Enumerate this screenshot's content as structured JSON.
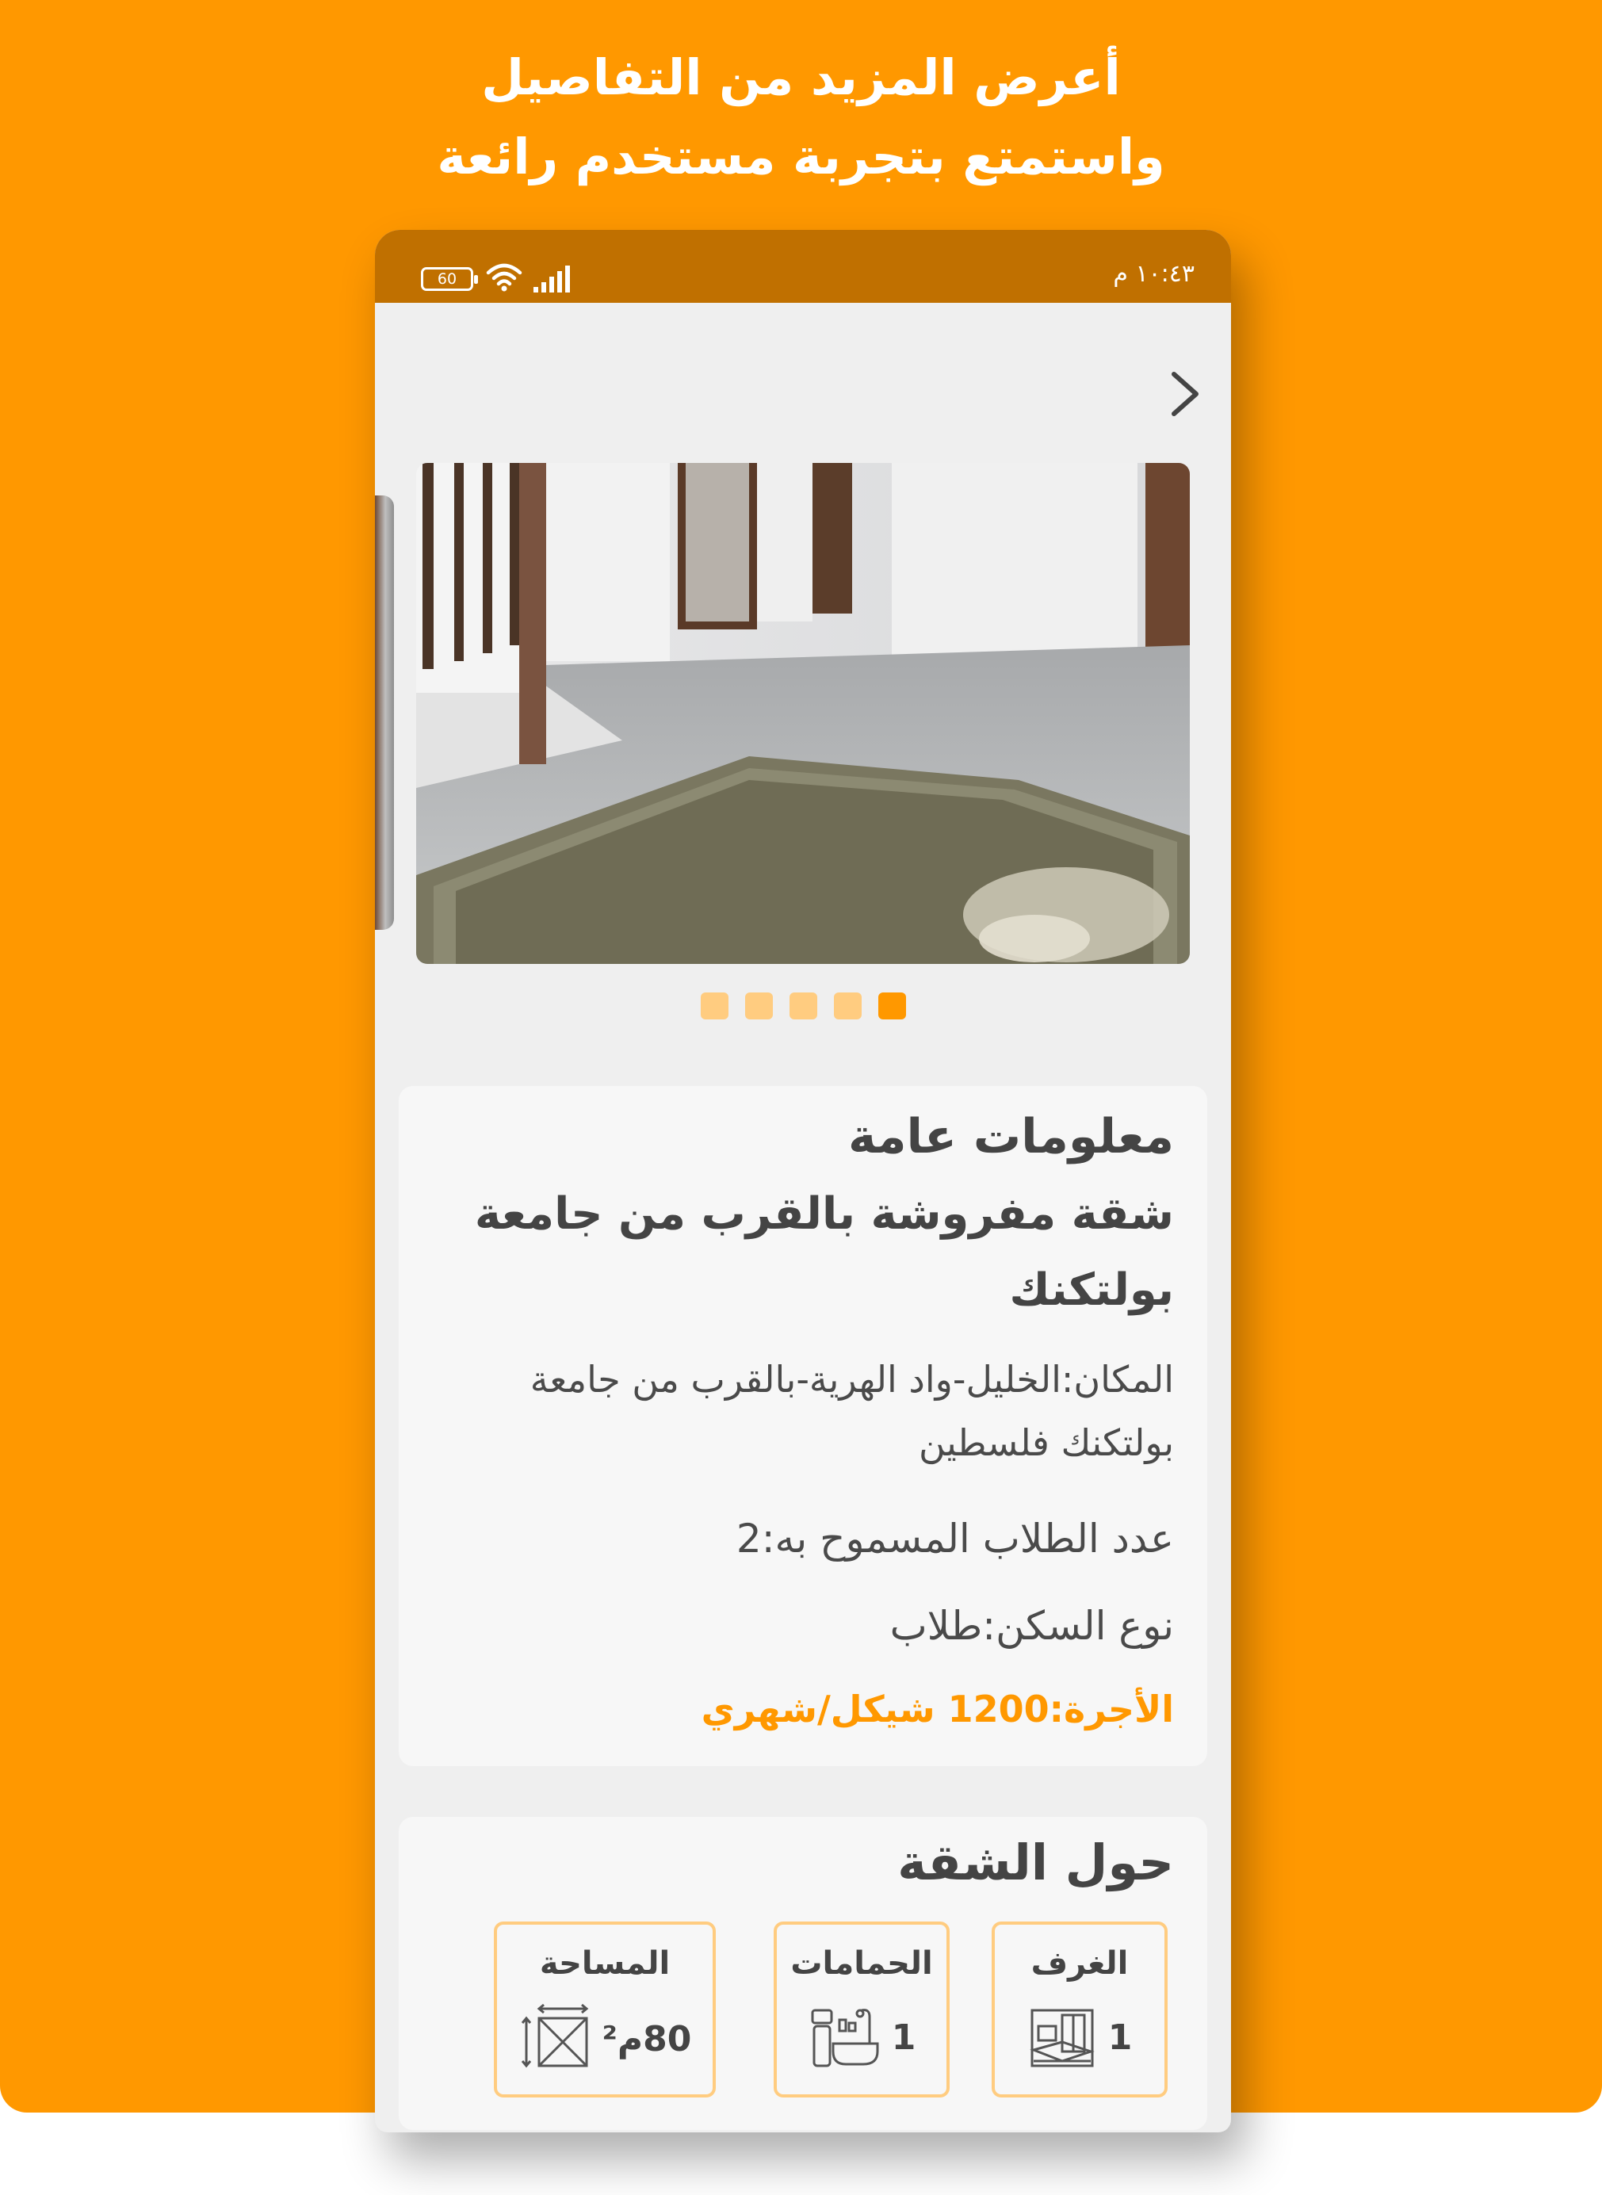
{
  "promo": {
    "line1": "أعرض المزيد من التفاصيل",
    "line2": "واستمتع بتجربة مستخدم رائعة"
  },
  "status_bar": {
    "battery": "60",
    "time": "١٠:٤٣ م",
    "icons": [
      "battery-icon",
      "wifi-icon",
      "signal-icon"
    ]
  },
  "nav": {
    "back_icon": "chevron-right-icon"
  },
  "gallery": {
    "image_count": 5,
    "active_index": 4,
    "image_desc": "apartment-interior-photo"
  },
  "general_info": {
    "heading": "معلومات عامة",
    "title_line1": "شقة مفروشة بالقرب من جامعة",
    "title_line2": "بولتكنك",
    "location_line1": "المكان:الخليل-واد الهرية-بالقرب من جامعة",
    "location_line2": "بولتكنك فلسطين",
    "students": "عدد الطلاب المسموح به:2",
    "housing_type": "نوع السكن:طلاب",
    "rent": "الأجرة:1200 شيكل/شهري"
  },
  "about": {
    "heading": "حول الشقة",
    "features": [
      {
        "label": "الغرف",
        "value": "1",
        "icon": "bedroom-icon"
      },
      {
        "label": "الحمامات",
        "value": "1",
        "icon": "bathroom-icon"
      },
      {
        "label": "المساحة",
        "value": "80م²",
        "icon": "area-icon"
      }
    ]
  },
  "colors": {
    "accent": "#FF9800",
    "accent_light": "#FFCC80",
    "status_bar": "#C07000",
    "card": "#F7F7F7",
    "screen_bg": "#EFEFEF"
  }
}
